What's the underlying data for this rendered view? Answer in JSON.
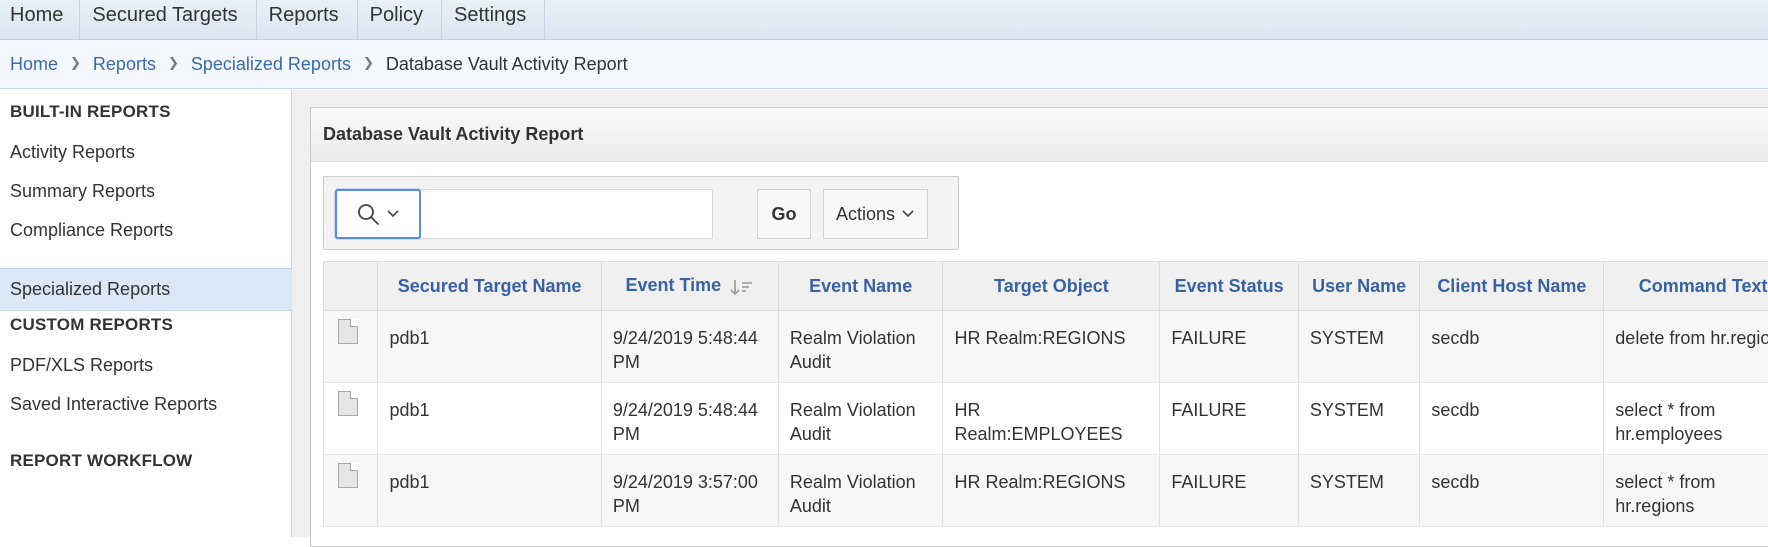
{
  "topnav": {
    "tabs": [
      "Home",
      "Secured Targets",
      "Reports",
      "Policy",
      "Settings"
    ]
  },
  "breadcrumb": {
    "items": [
      "Home",
      "Reports",
      "Specialized Reports"
    ],
    "current": "Database Vault Activity Report"
  },
  "sidebar": {
    "builtin_heading": "BUILT-IN REPORTS",
    "builtin_items": [
      "Activity Reports",
      "Summary Reports",
      "Compliance Reports",
      "Specialized Reports"
    ],
    "selected": "Specialized Reports",
    "custom_heading": "CUSTOM REPORTS",
    "custom_items": [
      "PDF/XLS Reports",
      "Saved Interactive Reports"
    ],
    "workflow_heading": "REPORT WORKFLOW"
  },
  "region": {
    "title": "Database Vault Activity Report"
  },
  "toolbar": {
    "search_value": "",
    "go_label": "Go",
    "actions_label": "Actions"
  },
  "table": {
    "columns": [
      "Secured Target Name",
      "Event Time",
      "Event Name",
      "Target Object",
      "Event Status",
      "User Name",
      "Client Host Name",
      "Command Text"
    ],
    "sorted_column": "Event Time",
    "sort_direction": "descending",
    "rows": [
      [
        "pdb1",
        "9/24/2019 5:48:44 PM",
        "Realm Violation Audit",
        "HR Realm:REGIONS",
        "FAILURE",
        "SYSTEM",
        "secdb",
        "delete from hr.regions"
      ],
      [
        "pdb1",
        "9/24/2019 5:48:44 PM",
        "Realm Violation Audit",
        "HR Realm:EMPLOYEES",
        "FAILURE",
        "SYSTEM",
        "secdb",
        "select * from hr.employees"
      ],
      [
        "pdb1",
        "9/24/2019 3:57:00 PM",
        "Realm Violation Audit",
        "HR Realm:REGIONS",
        "FAILURE",
        "SYSTEM",
        "secdb",
        "select * from hr.regions"
      ]
    ]
  }
}
